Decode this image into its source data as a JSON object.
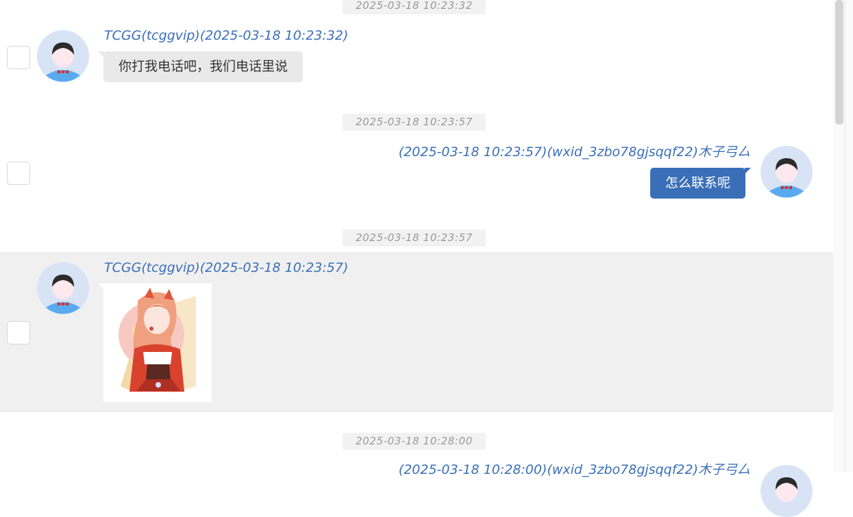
{
  "messages": [
    {
      "timestamp": "2025-03-18 10:23:32",
      "sender": "TCGG(tcggvip)(2025-03-18 10:23:32)",
      "text": "你打我电话吧，我们电话里说",
      "direction": "incoming"
    },
    {
      "timestamp": "2025-03-18 10:23:57",
      "sender": "(2025-03-18 10:23:57)(wxid_3zbo78gjsqqf22)木子弓厶",
      "text": "怎么联系呢",
      "direction": "outgoing"
    },
    {
      "timestamp": "2025-03-18 10:23:57",
      "sender": "TCGG(tcggvip)(2025-03-18 10:23:57)",
      "image": "anime-girl-illustration",
      "direction": "incoming",
      "highlighted": true
    },
    {
      "timestamp": "2025-03-18 10:28:00",
      "sender": "(2025-03-18 10:28:00)(wxid_3zbo78gjsqqf22)木子弓厶",
      "direction": "outgoing"
    }
  ],
  "colors": {
    "accent": "#3a6fb8",
    "incoming_bubble": "#e9e9e9",
    "highlight_row": "#f0f0f0",
    "timestamp_text": "#999999"
  },
  "icons": {
    "avatar": "user-avatar-icon",
    "checkbox": "select-checkbox"
  }
}
